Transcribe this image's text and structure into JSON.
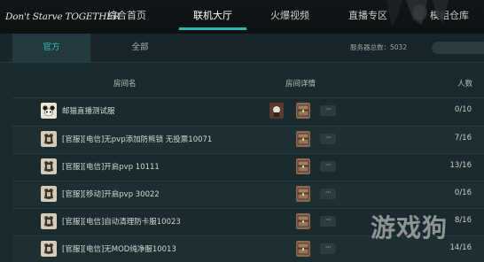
{
  "header": {
    "logo_text": "Don't Starve TOGETHER",
    "nav": [
      {
        "label": "综合首页"
      },
      {
        "label": "联机大厅"
      },
      {
        "label": "火爆视频"
      },
      {
        "label": "直播专区"
      },
      {
        "label": "模组仓库"
      }
    ],
    "active_nav": "联机大厅"
  },
  "tabs": [
    {
      "label": "官方"
    },
    {
      "label": "全部"
    }
  ],
  "server_count": "服务器总数：5032",
  "table": {
    "columns": {
      "name": "房间名",
      "detail": "房间详情",
      "players": "人数"
    },
    "rows": [
      {
        "name": "邮猫直播测试服",
        "count": "0/10",
        "icon": "panda-avatar-icon",
        "details": [
          "character-icon",
          "chest-icon"
        ]
      },
      {
        "name": "[官服][电信]无pvp添加防熊锁 无投票10071",
        "count": "7/16",
        "icon": "official-server-icon",
        "details": [
          "chest-icon"
        ]
      },
      {
        "name": "[官服][电信]开启pvp 10111",
        "count": "13/16",
        "icon": "official-server-icon",
        "details": [
          "chest-icon"
        ]
      },
      {
        "name": "[官服][移动]开启pvp 30022",
        "count": "0/16",
        "icon": "official-server-icon",
        "details": [
          "chest-icon"
        ]
      },
      {
        "name": "[官服][电信]自动清理防卡服10023",
        "count": "8/16",
        "icon": "official-server-icon",
        "details": [
          "chest-icon"
        ]
      },
      {
        "name": "[官服][电信]无MOD纯净服10013",
        "count": "14/16",
        "icon": "official-server-icon",
        "details": [
          "chest-icon"
        ]
      }
    ],
    "more_label": "···"
  },
  "watermark": "游戏狗",
  "colors": {
    "accent": "#2fb8b0",
    "background": "#1b2a2d",
    "topbar": "#0e1415"
  }
}
